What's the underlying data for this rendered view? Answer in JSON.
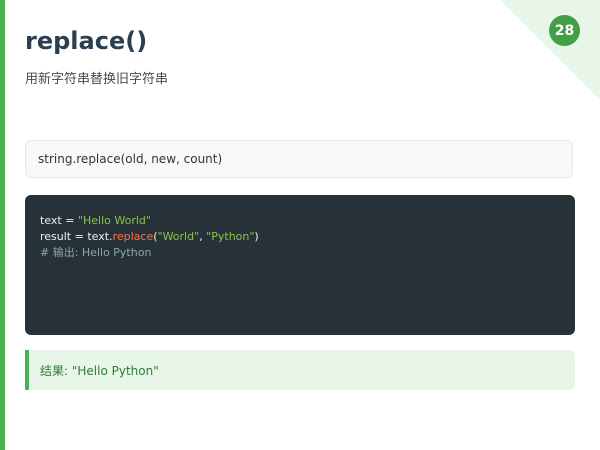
{
  "slide": {
    "page_number": "28",
    "title": "replace()",
    "subtitle": "用新字符串替换旧字符串"
  },
  "syntax": {
    "signature": "string.replace(old, new, count)"
  },
  "code": {
    "line1": {
      "var": "text",
      "op": " = ",
      "str": "\"Hello World\""
    },
    "line2": {
      "var": "result",
      "op": " = ",
      "obj": "text.",
      "method": "replace",
      "open": "(",
      "arg1": "\"World\"",
      "sep": ", ",
      "arg2": "\"Python\"",
      "close": ")"
    },
    "line3": {
      "comment": "# 输出: Hello Python"
    }
  },
  "result": {
    "text": "结果: \"Hello Python\""
  },
  "colors": {
    "accent": "#4caf50",
    "badge": "#43a047",
    "title": "#2c3e50",
    "code_background": "#263238",
    "result_background": "#e8f5e9"
  }
}
